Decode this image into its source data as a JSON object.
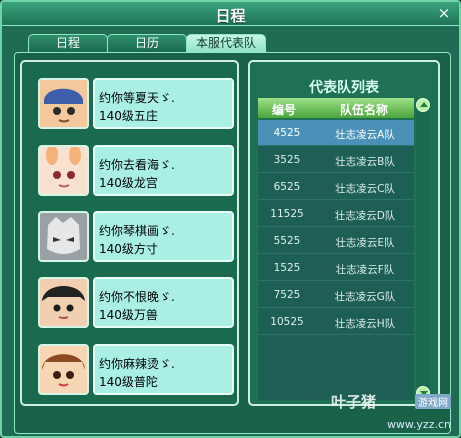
{
  "window": {
    "title": "日程",
    "close_glyph": "×"
  },
  "tabs": [
    {
      "label": "日程",
      "active": false
    },
    {
      "label": "日历",
      "active": false
    },
    {
      "label": "本服代表队",
      "active": true
    }
  ],
  "friends": [
    {
      "line1": "约你等夏天ゞ.",
      "line2": "140级五庄",
      "avatar": "blue-hat-boy-avatar"
    },
    {
      "line1": "约你去看海ゞ.",
      "line2": "140级龙宫",
      "avatar": "bunny-ear-girl-avatar"
    },
    {
      "line1": "约你琴棋画ゞ.",
      "line2": "140级方寸",
      "avatar": "white-mask-avatar"
    },
    {
      "line1": "约你不恨晚ゞ.",
      "line2": "140级万兽",
      "avatar": "black-hair-girl-avatar"
    },
    {
      "line1": "约你麻辣烫ゞ.",
      "line2": "140级普陀",
      "avatar": "brown-hair-girl-avatar"
    }
  ],
  "team_list": {
    "title": "代表队列表",
    "headers": {
      "id": "编号",
      "name": "队伍名称"
    },
    "rows": [
      {
        "id": "4525",
        "name": "壮志凌云A队",
        "selected": true
      },
      {
        "id": "3525",
        "name": "壮志凌云B队",
        "selected": false
      },
      {
        "id": "6525",
        "name": "壮志凌云C队",
        "selected": false
      },
      {
        "id": "11525",
        "name": "壮志凌云D队",
        "selected": false
      },
      {
        "id": "5525",
        "name": "壮志凌云E队",
        "selected": false
      },
      {
        "id": "1525",
        "name": "壮志凌云F队",
        "selected": false
      },
      {
        "id": "7525",
        "name": "壮志凌云G队",
        "selected": false
      },
      {
        "id": "10525",
        "name": "壮志凌云H队",
        "selected": false
      }
    ]
  },
  "watermark": {
    "brand": "叶子猪",
    "tag": "游戏网",
    "url": "www.yzz.cn"
  },
  "colors": {
    "accent": "#6fd3a8",
    "info_box": "#a9efe3",
    "selected_row": "#4a91b8"
  }
}
